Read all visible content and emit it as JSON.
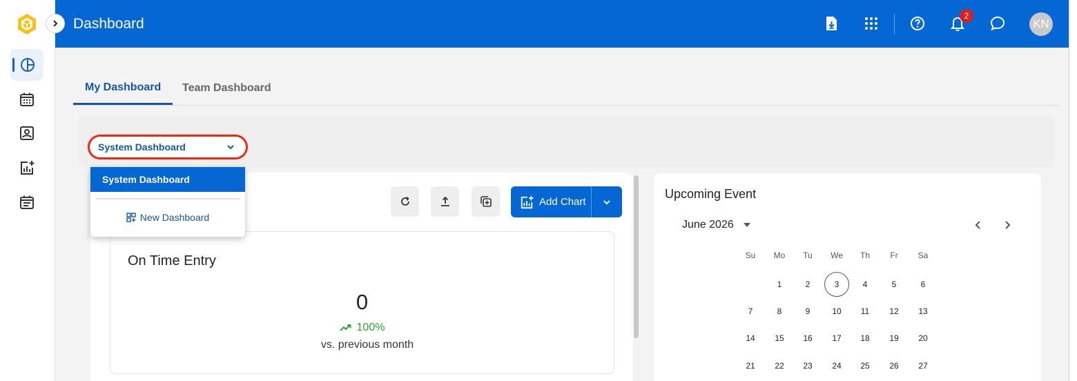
{
  "header": {
    "title": "Dashboard",
    "notification_count": "2",
    "avatar_initials": "KN"
  },
  "tabs": [
    {
      "label": "My Dashboard",
      "active": true
    },
    {
      "label": "Team Dashboard",
      "active": false
    }
  ],
  "dashboard_select": {
    "value": "System Dashboard",
    "options": [
      {
        "label": "System Dashboard",
        "selected": true
      }
    ],
    "new_dashboard_label": "New Dashboard"
  },
  "toolbar": {
    "add_chart_label": "Add Chart"
  },
  "card": {
    "title": "On Time Entry",
    "value": "0",
    "change": "100%",
    "comparison": "vs. previous month"
  },
  "calendar": {
    "title": "Upcoming Event",
    "month_label": "June 2026",
    "weekdays": [
      "Su",
      "Mo",
      "Tu",
      "We",
      "Th",
      "Fr",
      "Sa"
    ],
    "today": "3",
    "weeks": [
      [
        "",
        "1",
        "2",
        "3",
        "4",
        "5",
        "6"
      ],
      [
        "7",
        "8",
        "9",
        "10",
        "11",
        "12",
        "13"
      ],
      [
        "14",
        "15",
        "16",
        "17",
        "18",
        "19",
        "20"
      ],
      [
        "21",
        "22",
        "23",
        "24",
        "25",
        "26",
        "27"
      ]
    ]
  },
  "colors": {
    "header_blue": "#0467d4",
    "accent_blue": "#1556a6",
    "highlight_red": "#f0270f",
    "badge_red": "#d61f1f",
    "positive_green": "#2aa836"
  },
  "icons": {
    "rail": [
      "dashboard-icon",
      "calendar-grid-icon",
      "contact-card-icon",
      "add-chart-icon",
      "event-list-icon"
    ],
    "header": [
      "download-icon",
      "apps-grid-icon",
      "help-icon",
      "bell-icon",
      "chat-icon"
    ]
  }
}
